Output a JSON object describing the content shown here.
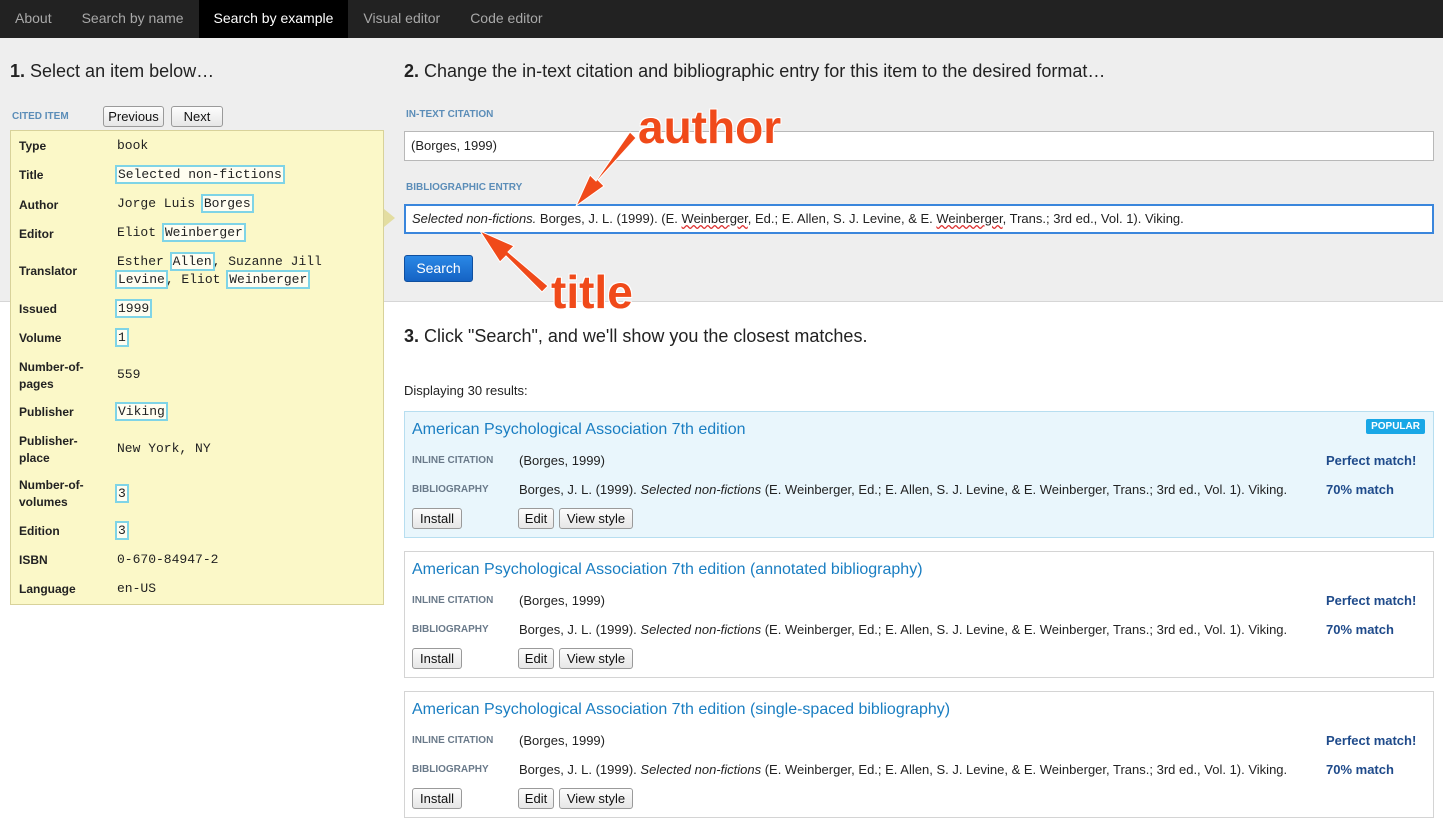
{
  "nav": {
    "tabs": [
      "About",
      "Search by name",
      "Search by example",
      "Visual editor",
      "Code editor"
    ],
    "active": "Search by example"
  },
  "step1": {
    "number": "1.",
    "text": "Select an item below…"
  },
  "step2": {
    "number": "2.",
    "text": "Change the in-text citation and bibliographic entry for this item to the desired format…"
  },
  "step3": {
    "number": "3.",
    "text": "Click \"Search\", and we'll show you the closest matches."
  },
  "cited_item": {
    "label": "CITED ITEM",
    "previous": "Previous",
    "next": "Next",
    "fields": {
      "type": {
        "name": "Type",
        "value": "book"
      },
      "title": {
        "name": "Title",
        "value": "Selected non-fictions"
      },
      "author": {
        "name": "Author",
        "value_pre": "Jorge Luis ",
        "value_hl": "Borges"
      },
      "editor": {
        "name": "Editor",
        "value_pre": "Eliot ",
        "value_hl": "Weinberger"
      },
      "translator": {
        "name": "Translator",
        "l1_pre": "Esther ",
        "l1_hl": "Allen",
        "l1_post": ", Suzanne Jill",
        "l2_hl1": "Levine",
        "l2_mid": ", Eliot ",
        "l2_hl2": "Weinberger"
      },
      "issued": {
        "name": "Issued",
        "value": "1999"
      },
      "volume": {
        "name": "Volume",
        "value": "1"
      },
      "pages": {
        "name1": "Number-of-",
        "name2": "pages",
        "value": "559"
      },
      "publisher": {
        "name": "Publisher",
        "value": "Viking"
      },
      "place": {
        "name1": "Publisher-",
        "name2": "place",
        "value": "New York, NY"
      },
      "volumes": {
        "name1": "Number-of-",
        "name2": "volumes",
        "value": "3"
      },
      "edition": {
        "name": "Edition",
        "value": "3"
      },
      "isbn": {
        "name": "ISBN",
        "value": "0-670-84947-2"
      },
      "language": {
        "name": "Language",
        "value": "en-US"
      }
    }
  },
  "intext": {
    "label": "IN-TEXT CITATION",
    "value": "(Borges, 1999)"
  },
  "bib": {
    "label": "BIBLIOGRAPHIC ENTRY",
    "italic": "Selected non-fictions.",
    "p1": " Borges, J. L. (1999). (E. ",
    "w1": "Weinberger",
    "p2": ", Ed.; E. Allen, S. J. Levine, & E. ",
    "w2": "Weinberger",
    "p3": ", Trans.; 3rd ed., Vol. 1). Viking."
  },
  "search_button": "Search",
  "annotations": {
    "author": "author",
    "title": "title"
  },
  "results_count": "Displaying 30 results:",
  "results": [
    {
      "title": "American Psychological Association 7th edition",
      "badge": "POPULAR",
      "inline_label": "INLINE CITATION",
      "inline": "(Borges, 1999)",
      "inline_match": "Perfect match!",
      "bib_label": "BIBLIOGRAPHY",
      "bib_pre": "Borges, J. L. (1999). ",
      "bib_italic": "Selected non-fictions",
      "bib_post": " (E. Weinberger, Ed.; E. Allen, S. J. Levine, & E. Weinberger, Trans.; 3rd ed., Vol. 1). Viking.",
      "bib_match": "70% match",
      "install": "Install",
      "edit": "Edit",
      "view": "View style"
    },
    {
      "title": "American Psychological Association 7th edition (annotated bibliography)",
      "inline_label": "INLINE CITATION",
      "inline": "(Borges, 1999)",
      "inline_match": "Perfect match!",
      "bib_label": "BIBLIOGRAPHY",
      "bib_pre": "Borges, J. L. (1999). ",
      "bib_italic": "Selected non-fictions",
      "bib_post": " (E. Weinberger, Ed.; E. Allen, S. J. Levine, & E. Weinberger, Trans.; 3rd ed., Vol. 1). Viking.",
      "bib_match": "70% match",
      "install": "Install",
      "edit": "Edit",
      "view": "View style"
    },
    {
      "title": "American Psychological Association 7th edition (single-spaced bibliography)",
      "inline_label": "INLINE CITATION",
      "inline": "(Borges, 1999)",
      "inline_match": "Perfect match!",
      "bib_label": "BIBLIOGRAPHY",
      "bib_pre": "Borges, J. L. (1999). ",
      "bib_italic": "Selected non-fictions",
      "bib_post": " (E. Weinberger, Ed.; E. Allen, S. J. Levine, & E. Weinberger, Trans.; 3rd ed., Vol. 1). Viking.",
      "bib_match": "70% match",
      "install": "Install",
      "edit": "Edit",
      "view": "View style"
    }
  ]
}
